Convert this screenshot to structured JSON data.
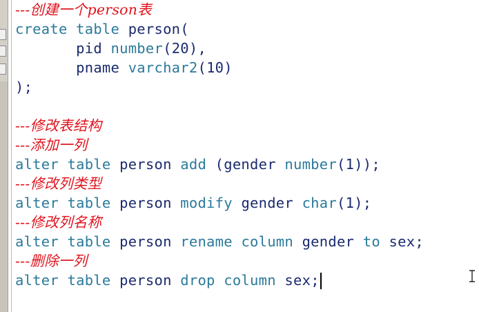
{
  "editor": {
    "lines": [
      {
        "comment": "---创建一个person表"
      },
      {
        "tokens": [
          [
            "kw",
            "create"
          ],
          [
            "sp",
            " "
          ],
          [
            "kw",
            "table"
          ],
          [
            "sp",
            " "
          ],
          [
            "id",
            "person"
          ],
          [
            "pun",
            "("
          ]
        ]
      },
      {
        "tokens": [
          [
            "sp",
            "       "
          ],
          [
            "id",
            "pid"
          ],
          [
            "sp",
            " "
          ],
          [
            "kw",
            "number"
          ],
          [
            "pun",
            "("
          ],
          [
            "num",
            "20"
          ],
          [
            "pun",
            "),"
          ]
        ]
      },
      {
        "tokens": [
          [
            "sp",
            "       "
          ],
          [
            "id",
            "pname"
          ],
          [
            "sp",
            " "
          ],
          [
            "kw",
            "varchar2"
          ],
          [
            "pun",
            "("
          ],
          [
            "num",
            "10"
          ],
          [
            "pun",
            ")"
          ]
        ]
      },
      {
        "tokens": [
          [
            "pun",
            ");"
          ]
        ]
      },
      {
        "tokens": []
      },
      {
        "comment": "---修改表结构"
      },
      {
        "comment": "---添加一列"
      },
      {
        "tokens": [
          [
            "kw",
            "alter"
          ],
          [
            "sp",
            " "
          ],
          [
            "kw",
            "table"
          ],
          [
            "sp",
            " "
          ],
          [
            "id",
            "person"
          ],
          [
            "sp",
            " "
          ],
          [
            "kw",
            "add"
          ],
          [
            "sp",
            " "
          ],
          [
            "pun",
            "("
          ],
          [
            "id",
            "gender"
          ],
          [
            "sp",
            " "
          ],
          [
            "kw",
            "number"
          ],
          [
            "pun",
            "("
          ],
          [
            "num",
            "1"
          ],
          [
            "pun",
            "));"
          ]
        ]
      },
      {
        "comment": "---修改列类型"
      },
      {
        "tokens": [
          [
            "kw",
            "alter"
          ],
          [
            "sp",
            " "
          ],
          [
            "kw",
            "table"
          ],
          [
            "sp",
            " "
          ],
          [
            "id",
            "person"
          ],
          [
            "sp",
            " "
          ],
          [
            "kw",
            "modify"
          ],
          [
            "sp",
            " "
          ],
          [
            "id",
            "gender"
          ],
          [
            "sp",
            " "
          ],
          [
            "kw",
            "char"
          ],
          [
            "pun",
            "("
          ],
          [
            "num",
            "1"
          ],
          [
            "pun",
            ");"
          ]
        ]
      },
      {
        "comment": "---修改列名称"
      },
      {
        "tokens": [
          [
            "kw",
            "alter"
          ],
          [
            "sp",
            " "
          ],
          [
            "kw",
            "table"
          ],
          [
            "sp",
            " "
          ],
          [
            "id",
            "person"
          ],
          [
            "sp",
            " "
          ],
          [
            "kw",
            "rename"
          ],
          [
            "sp",
            " "
          ],
          [
            "kw",
            "column"
          ],
          [
            "sp",
            " "
          ],
          [
            "id",
            "gender"
          ],
          [
            "sp",
            " "
          ],
          [
            "kw",
            "to"
          ],
          [
            "sp",
            " "
          ],
          [
            "id",
            "sex"
          ],
          [
            "pun",
            ";"
          ]
        ]
      },
      {
        "comment": "---删除一列"
      },
      {
        "tokens": [
          [
            "kw",
            "alter"
          ],
          [
            "sp",
            " "
          ],
          [
            "kw",
            "table"
          ],
          [
            "sp",
            " "
          ],
          [
            "id",
            "person"
          ],
          [
            "sp",
            " "
          ],
          [
            "kw",
            "drop"
          ],
          [
            "sp",
            " "
          ],
          [
            "kw",
            "column"
          ],
          [
            "sp",
            " "
          ],
          [
            "id",
            "sex"
          ],
          [
            "pun",
            ";"
          ]
        ],
        "caret": true
      }
    ]
  },
  "colors": {
    "comment": "#e0141e",
    "keyword": "#2a7a9a",
    "identifier": "#1a2a6e",
    "background": "#ffffff",
    "gutter": "#d4d0c8"
  },
  "cursor_icon": "text-ibeam-icon"
}
